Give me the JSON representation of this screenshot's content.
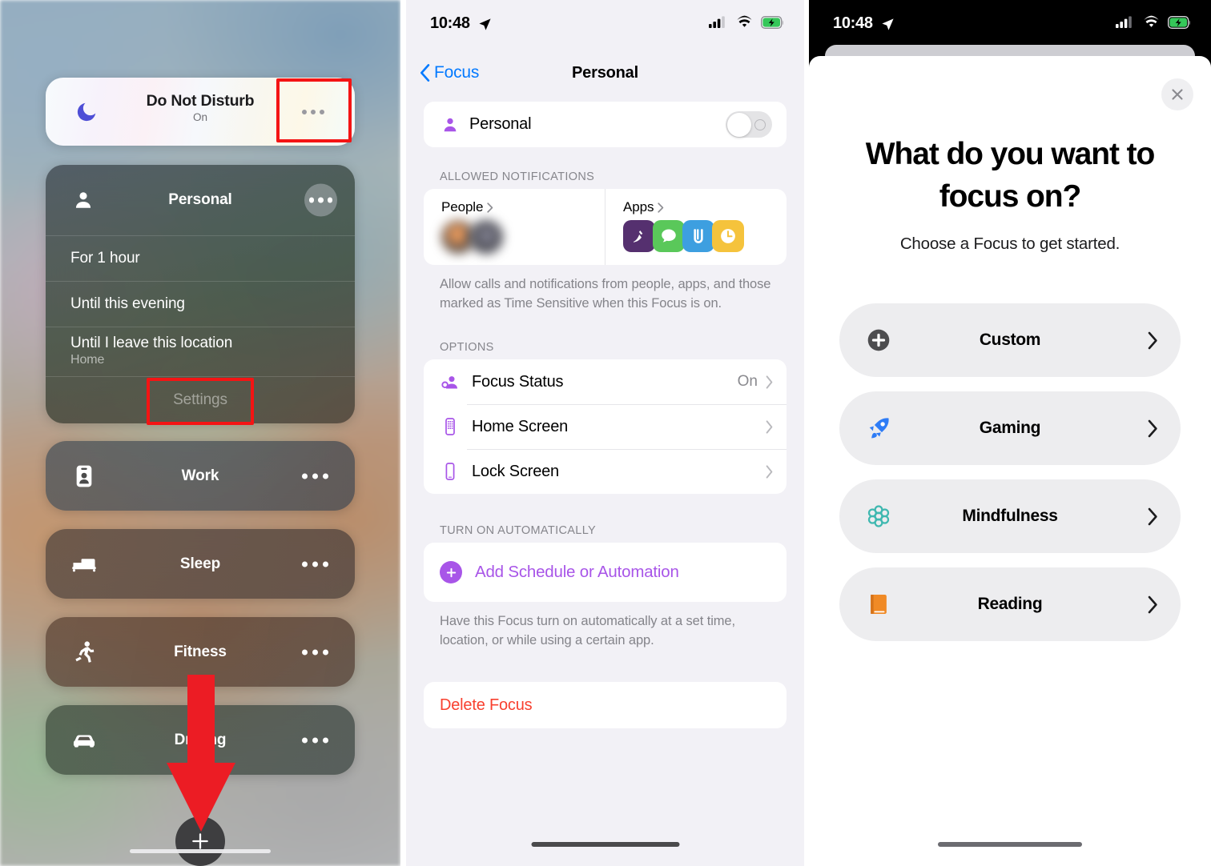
{
  "control_center": {
    "dnd": {
      "title": "Do Not Disturb",
      "status": "On",
      "icon": "moon-icon",
      "more": "more-options"
    },
    "personal_card": {
      "title": "Personal",
      "icon": "person-icon",
      "rows": [
        {
          "label": "For 1 hour",
          "sub": ""
        },
        {
          "label": "Until this evening",
          "sub": ""
        },
        {
          "label": "Until I leave this location",
          "sub": "Home"
        }
      ],
      "settings_label": "Settings"
    },
    "focus_pills": [
      {
        "label": "Work",
        "icon": "id-card-icon"
      },
      {
        "label": "Sleep",
        "icon": "bed-icon"
      },
      {
        "label": "Fitness",
        "icon": "running-icon"
      },
      {
        "label": "Driving",
        "icon": "car-icon"
      }
    ],
    "add_button": "add-focus-button"
  },
  "settings": {
    "status_bar": {
      "time": "10:48",
      "location_icon": "location-arrow-icon",
      "cellular": "cellular-icon",
      "wifi": "wifi-icon",
      "battery": "battery-charging-icon"
    },
    "nav": {
      "back_label": "Focus",
      "title": "Personal"
    },
    "name_row": {
      "label": "Personal",
      "icon": "person-icon",
      "toggle_state": "off"
    },
    "allowed_notifications": {
      "header": "ALLOWED NOTIFICATIONS",
      "people_tile": {
        "label": "People",
        "avatar_count": 2
      },
      "apps_tile": {
        "label": "Apps",
        "apps": [
          {
            "name": "podcasts-app-icon",
            "color": "#55306f"
          },
          {
            "name": "messages-app-icon",
            "color": "#5ac85a"
          },
          {
            "name": "mail-app-icon",
            "color": "#3d9fe0"
          },
          {
            "name": "clock-app-icon",
            "color": "#f5c33c"
          }
        ]
      },
      "footnote": "Allow calls and notifications from people, apps, and those marked as Time Sensitive when this Focus is on."
    },
    "options": {
      "header": "OPTIONS",
      "rows": [
        {
          "label": "Focus Status",
          "value": "On",
          "icon": "focus-status-icon"
        },
        {
          "label": "Home Screen",
          "value": "",
          "icon": "home-screen-icon"
        },
        {
          "label": "Lock Screen",
          "value": "",
          "icon": "lock-screen-icon"
        }
      ]
    },
    "turn_on_automatically": {
      "header": "TURN ON AUTOMATICALLY",
      "add_label": "Add Schedule or Automation",
      "footnote": "Have this Focus turn on automatically at a set time, location, or while using a certain app."
    },
    "delete_label": "Delete Focus",
    "accent": "#a855e8",
    "destructive": "#f8402f",
    "link": "#047aff"
  },
  "focus_picker": {
    "status_bar": {
      "time": "10:48",
      "location_icon": "location-arrow-icon"
    },
    "close_label": "close-button",
    "title": "What do you want to focus on?",
    "subtitle": "Choose a Focus to get started.",
    "options": [
      {
        "label": "Custom",
        "icon": "plus-circle-icon",
        "color": "#4d4d4f"
      },
      {
        "label": "Gaming",
        "icon": "rocket-icon",
        "color": "#2e7cf6"
      },
      {
        "label": "Mindfulness",
        "icon": "flower-icon",
        "color": "#3fb8b0"
      },
      {
        "label": "Reading",
        "icon": "book-icon",
        "color": "#f08a26"
      }
    ]
  },
  "annotations": {
    "highlight_color": "#f41414",
    "boxes": [
      "dnd-more-button-highlight",
      "settings-button-highlight"
    ],
    "arrow": "down-arrow-to-add-button"
  }
}
